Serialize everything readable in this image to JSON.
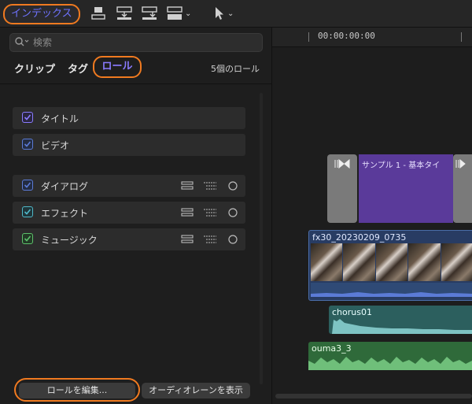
{
  "toolbar": {
    "index_button": "インデックス",
    "icons": [
      "connect-clip-icon",
      "insert-clip-icon",
      "append-clip-icon",
      "overwrite-clip-icon",
      "select-tool-icon"
    ]
  },
  "search": {
    "placeholder": "検索"
  },
  "tabs": {
    "clips": "クリップ",
    "tags": "タグ",
    "roles": "ロール"
  },
  "role_count": "5個のロール",
  "video_roles": [
    {
      "label": "タイトル",
      "color": "#8a7bff",
      "checked": true
    },
    {
      "label": "ビデオ",
      "color": "#5b7bd6",
      "checked": true
    }
  ],
  "audio_roles": [
    {
      "label": "ダイアログ",
      "color": "#5b7bd6",
      "checked": true
    },
    {
      "label": "エフェクト",
      "color": "#4fb8c8",
      "checked": true
    },
    {
      "label": "ミュージック",
      "color": "#5cc06a",
      "checked": true
    }
  ],
  "buttons": {
    "edit_roles": "ロールを編集...",
    "show_audio_lanes": "オーディオレーンを表示"
  },
  "timeline": {
    "timecode": "00:00:00:00",
    "title_clip": "サンプル 1 - 基本タイ",
    "video_clip": "fx30_20230209_0735",
    "chorus_clip": "chorus01",
    "music_clip": "ouma3_3"
  },
  "colors": {
    "highlight": "#f07a20",
    "accent": "#6f73ff"
  }
}
